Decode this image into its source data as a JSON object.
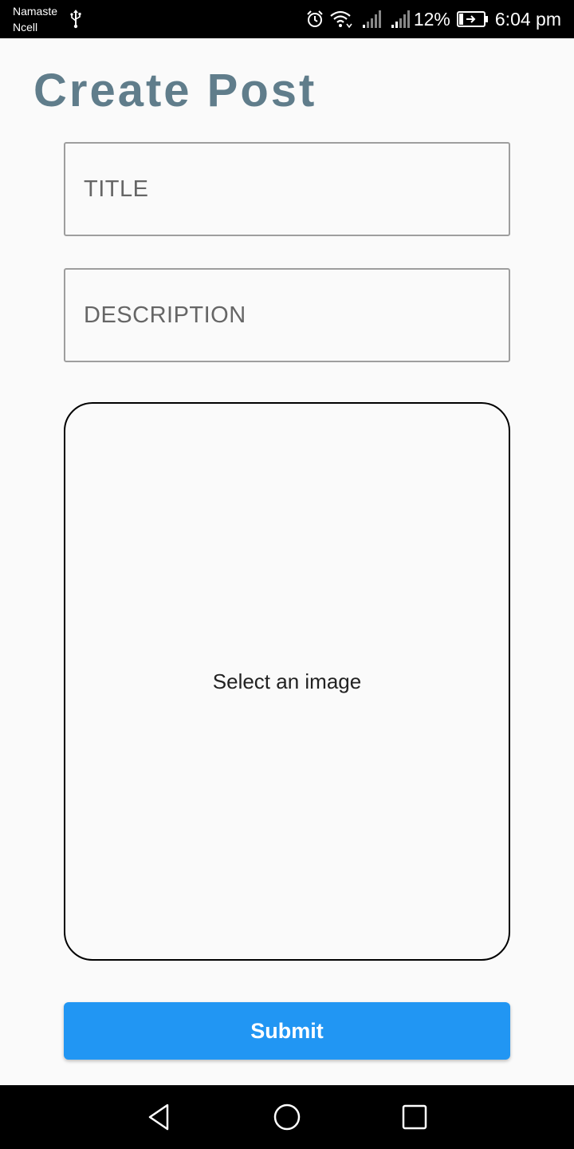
{
  "status_bar": {
    "carrier_line1": "Namaste",
    "carrier_line2": "Ncell",
    "battery_percent": "12%",
    "time": "6:04 pm",
    "icons": [
      "usb-icon",
      "alarm-icon",
      "wifi-icon",
      "signal-icon",
      "signal-icon",
      "battery-charging-icon"
    ]
  },
  "page": {
    "title": "Create Post"
  },
  "form": {
    "title_placeholder": "TITLE",
    "title_value": "",
    "description_placeholder": "DESCRIPTION",
    "description_value": "",
    "image_picker_label": "Select an image",
    "submit_label": "Submit"
  },
  "nav_bar": {
    "icons": [
      "back-icon",
      "home-icon",
      "recents-icon"
    ]
  },
  "colors": {
    "title": "#607d8b",
    "submit_button": "#2196f3",
    "background": "#fafafa",
    "system_bars": "#000000"
  }
}
